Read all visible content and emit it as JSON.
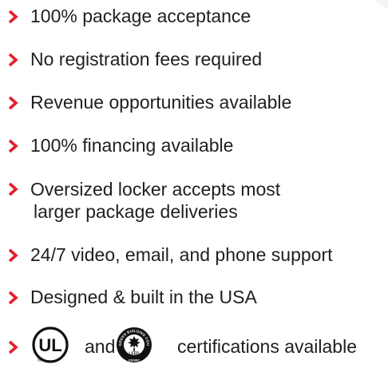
{
  "accent_color": "#e21f2d",
  "text_color": "#1f1f1f",
  "bullet_icon": "chevron-right-icon",
  "features": [
    {
      "lines": [
        "100% package acceptance"
      ]
    },
    {
      "lines": [
        "No registration fees required"
      ]
    },
    {
      "lines": [
        "Revenue opportunities available"
      ]
    },
    {
      "lines": [
        "100% financing available"
      ]
    },
    {
      "lines": [
        "Oversized locker accepts most",
        "larger package deliveries"
      ]
    },
    {
      "lines": [
        "24/7 video, email, and phone support"
      ]
    },
    {
      "lines": [
        "Designed & built in the USA"
      ]
    }
  ],
  "certifications": {
    "ul_logo_text": "UL",
    "ul_logo_mark": "®",
    "and_text": "and",
    "leed_logo_ring_text": "U.S. GREEN BUILDING COUNCIL",
    "leed_logo_center_text": "LEED",
    "leed_logo_bottom_text": "USGBC",
    "suffix_text": "certifications available"
  }
}
